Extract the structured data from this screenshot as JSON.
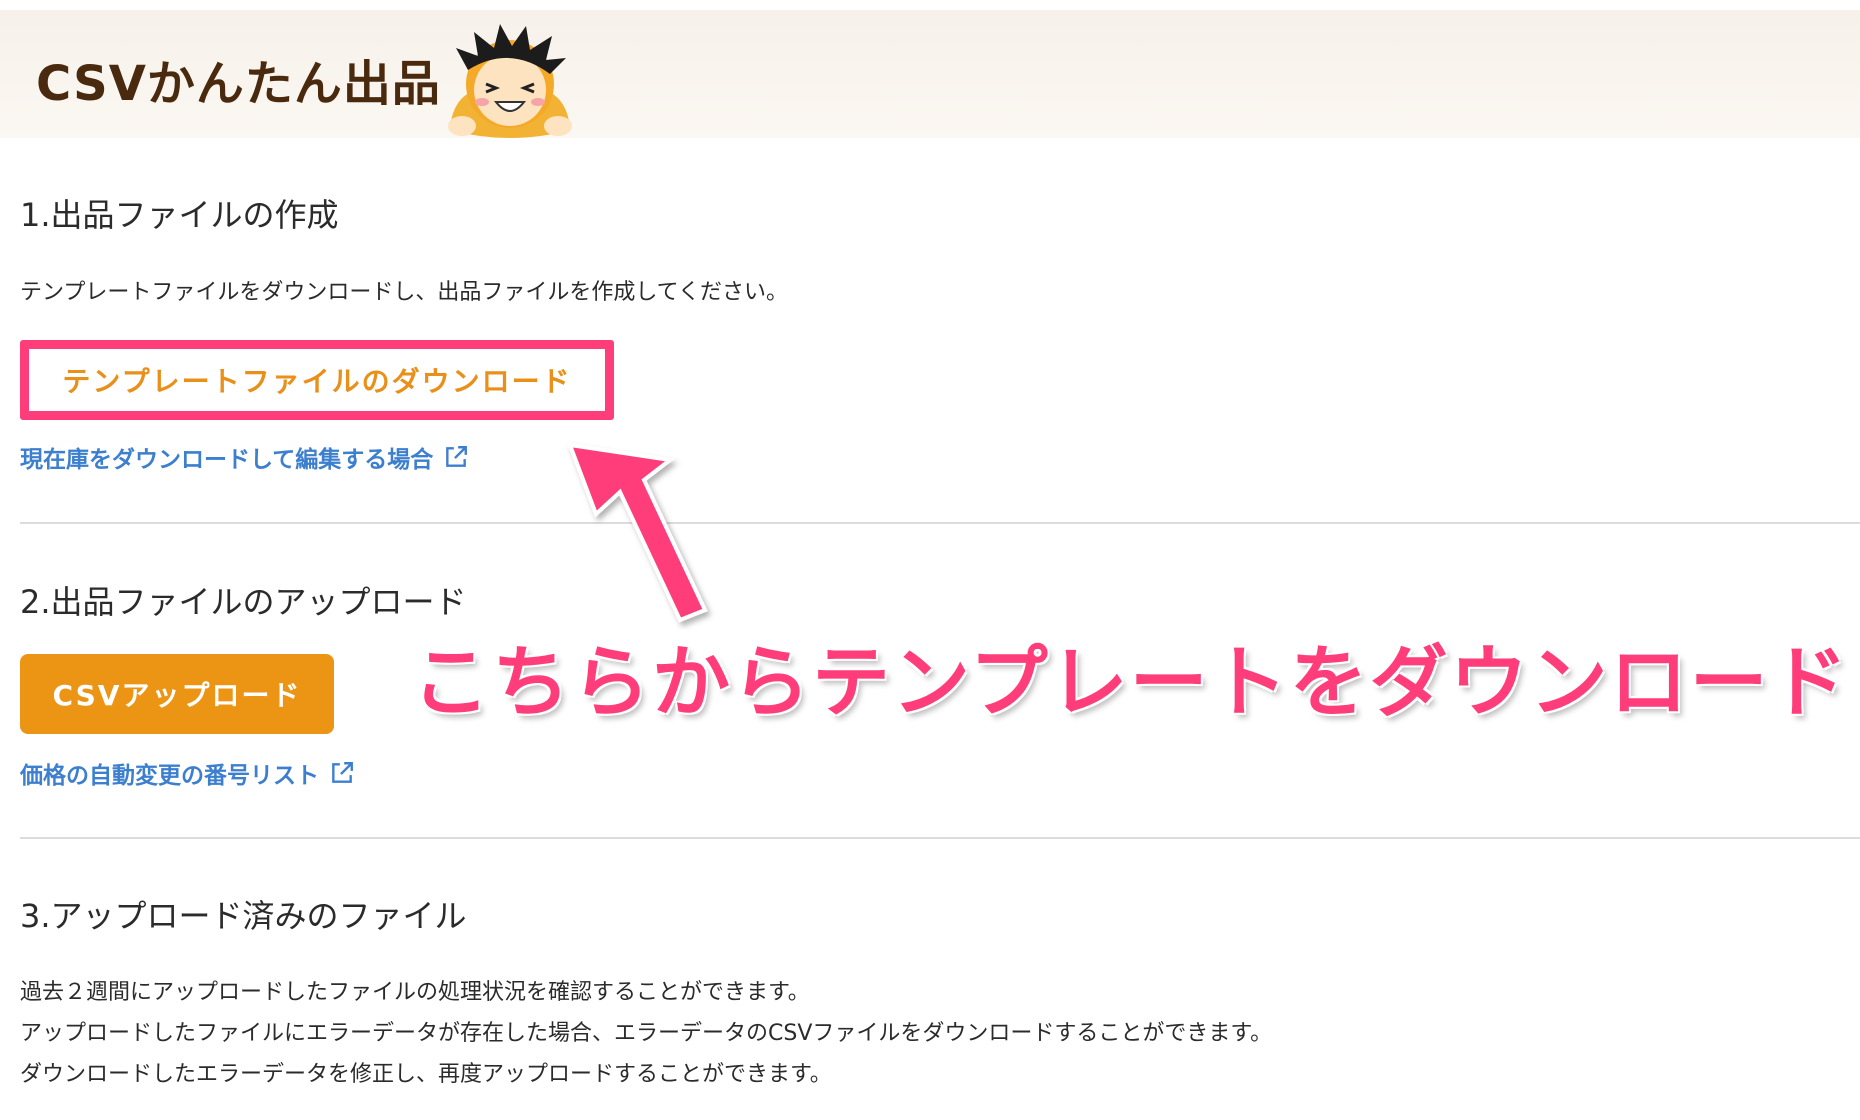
{
  "header": {
    "title": "CSVかんたん出品",
    "mascot": "smiling-boy-mascot"
  },
  "section1": {
    "heading": "1.出品ファイルの作成",
    "description": "テンプレートファイルをダウンロードし、出品ファイルを作成してください。",
    "template_button": "テンプレートファイルのダウンロード",
    "inventory_link": "現在庫をダウンロードして編集する場合"
  },
  "section2": {
    "heading": "2.出品ファイルのアップロード",
    "csv_button": "CSVアップロード",
    "price_link": "価格の自動変更の番号リスト"
  },
  "section3": {
    "heading": "3.アップロード済みのファイル",
    "lines": [
      "過去２週間にアップロードしたファイルの処理状況を確認することができます。",
      "アップロードしたファイルにエラーデータが存在した場合、エラーデータのCSVファイルをダウンロードすることができます。",
      "ダウンロードしたエラーデータを修正し、再度アップロードすることができます。"
    ]
  },
  "annotation": {
    "callout": "こちらからテンプレートをダウンロード",
    "color": "#ff3d7a"
  },
  "colors": {
    "accent_orange": "#ec9414",
    "link_blue": "#3d7fcf",
    "title_brown": "#4a2a0e"
  }
}
